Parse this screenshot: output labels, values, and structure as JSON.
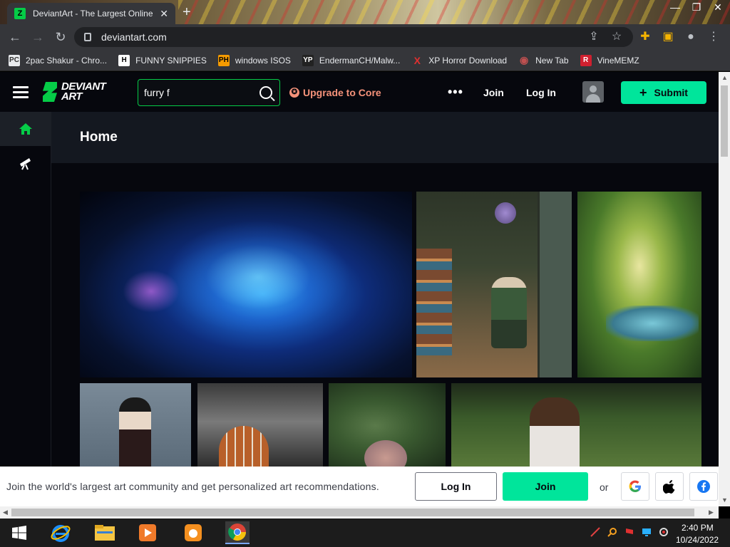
{
  "browser": {
    "tab_title": "DeviantArt - The Largest Online",
    "tab_close": "✕",
    "new_tab": "+",
    "url": "deviantart.com",
    "window_controls": [
      "—",
      "❐",
      "✕"
    ]
  },
  "bookmarks": [
    {
      "label": "2pac Shakur - Chro...",
      "icon": "PC",
      "color": "#e8eaed"
    },
    {
      "label": "FUNNY SNIPPIES",
      "icon": "H",
      "color": "#ffffff"
    },
    {
      "label": "windows ISOS",
      "icon": "PH",
      "color": "#f59b00"
    },
    {
      "label": "EndermanCH/Malw...",
      "icon": "YP",
      "color": "#ffffff"
    },
    {
      "label": "XP Horror Download",
      "icon": "X",
      "color": "#e03030"
    },
    {
      "label": "New Tab",
      "icon": "◉",
      "color": "#c05050"
    },
    {
      "label": "VineMEMZ",
      "icon": "R",
      "color": "#d0202f"
    }
  ],
  "header": {
    "logo_line1": "DEVIANT",
    "logo_line2": "ART",
    "search_value": "furry f",
    "upgrade_label": "Upgrade to Core",
    "more_label": "•••",
    "join_label": "Join",
    "login_label": "Log In",
    "submit_label": "Submit"
  },
  "page": {
    "title": "Home"
  },
  "banner": {
    "text": "Join the world's largest art community and get personalized art recommendations.",
    "login_label": "Log In",
    "join_label": "Join",
    "or_label": "or"
  },
  "taskbar": {
    "time": "2:40 PM",
    "date": "10/24/2022"
  },
  "colors": {
    "accent": "#00e59b",
    "brand": "#05cc47",
    "upgrade": "#f5927a"
  }
}
